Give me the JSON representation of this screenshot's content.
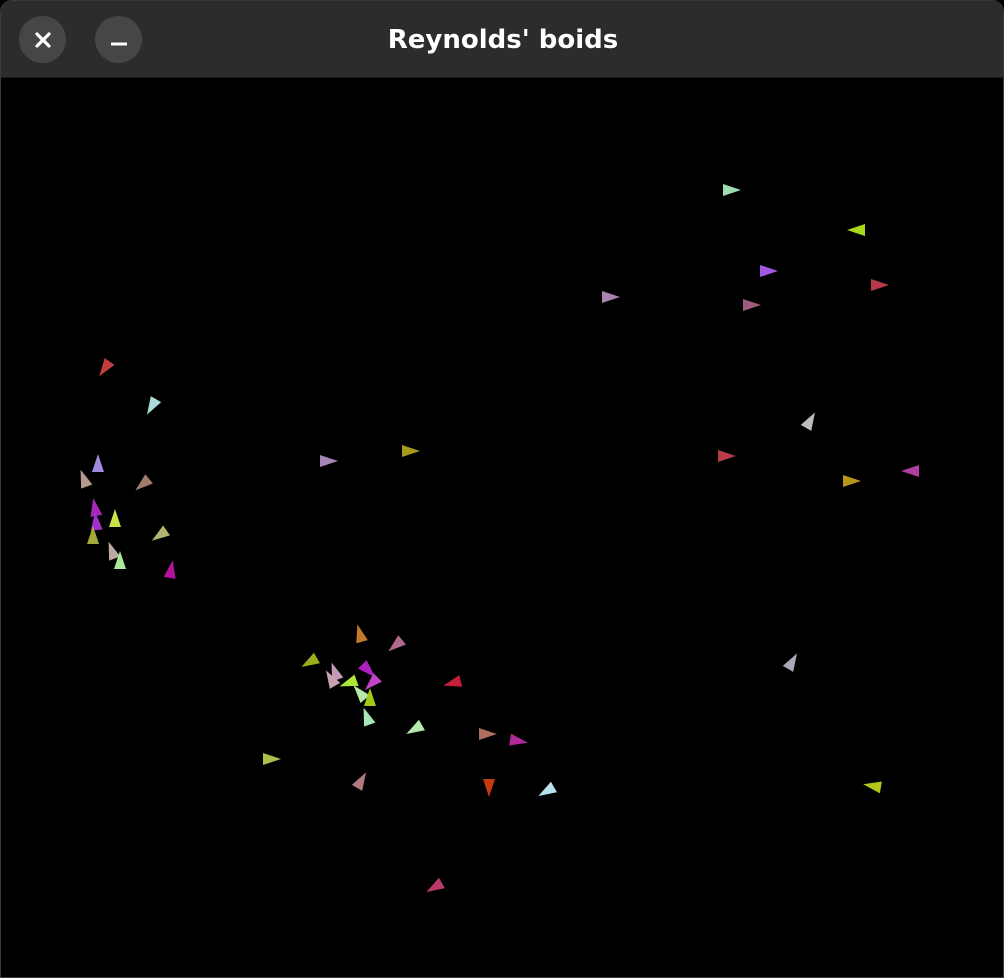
{
  "window": {
    "title": "Reynolds' boids",
    "close_icon": "close-icon",
    "minimize_icon": "minimize-icon",
    "titlebar_color": "#2c2c2c",
    "background_color": "#000000"
  },
  "boids": [
    {
      "color": "#9fdcb1",
      "heading": 0
    },
    {
      "color": "#a8d81a",
      "heading": 180
    },
    {
      "color": "#a459e6",
      "heading": 0
    },
    {
      "color": "#b83a47",
      "heading": 0
    },
    {
      "color": "#a883b0",
      "heading": 0
    },
    {
      "color": "#9e5b7d",
      "heading": 0
    },
    {
      "color": "#c33b3b",
      "heading": 125
    },
    {
      "color": "#a8dcd8",
      "heading": 120
    },
    {
      "color": "#bdbdbd",
      "heading": 300
    },
    {
      "color": "#b83a47",
      "heading": 0
    },
    {
      "color": "#b33ea1",
      "heading": 180
    },
    {
      "color": "#b8961e",
      "heading": 0
    },
    {
      "color": "#a99a1e",
      "heading": 0
    },
    {
      "color": "#a883b8",
      "heading": 0
    },
    {
      "color": "#a18adc",
      "heading": 270
    },
    {
      "color": "#b39b8e",
      "heading": 250
    },
    {
      "color": "#9e7b6e",
      "heading": 140
    },
    {
      "color": "#a529b6",
      "heading": 260
    },
    {
      "color": "#9e32c8",
      "heading": 265
    },
    {
      "color": "#c8e04a",
      "heading": 270
    },
    {
      "color": "#b5b36e",
      "heading": 145
    },
    {
      "color": "#b9a9a0",
      "heading": 250
    },
    {
      "color": "#a7e99b",
      "heading": 270
    },
    {
      "color": "#a6a83c",
      "heading": 270
    },
    {
      "color": "#b3129a",
      "heading": 280
    },
    {
      "color": "#c07a2a",
      "heading": 255
    },
    {
      "color": "#b0688e",
      "heading": 140
    },
    {
      "color": "#9cac1a",
      "heading": 150
    },
    {
      "color": "#c39ab8",
      "heading": 250
    },
    {
      "color": "#c5a3ac",
      "heading": 240
    },
    {
      "color": "#aee636",
      "heading": 160
    },
    {
      "color": "#b8e8a8",
      "heading": 230
    },
    {
      "color": "#b022c0",
      "heading": 45
    },
    {
      "color": "#c044c4",
      "heading": 135
    },
    {
      "color": "#9fc818",
      "heading": 270
    },
    {
      "color": "#a6e6b8",
      "heading": 250
    },
    {
      "color": "#c31e3a",
      "heading": 165
    },
    {
      "color": "#b8e8b0",
      "heading": 150
    },
    {
      "color": "#b06e5e",
      "heading": 0
    },
    {
      "color": "#b02a9a",
      "heading": 10
    },
    {
      "color": "#a8c24a",
      "heading": 0
    },
    {
      "color": "#b07a7e",
      "heading": 300
    },
    {
      "color": "#c43a12",
      "heading": 90
    },
    {
      "color": "#b8e2ec",
      "heading": 150
    },
    {
      "color": "#a8a8b8",
      "heading": 300
    },
    {
      "color": "#b5c61a",
      "heading": 190
    },
    {
      "color": "#b83a6a",
      "heading": 150
    }
  ]
}
